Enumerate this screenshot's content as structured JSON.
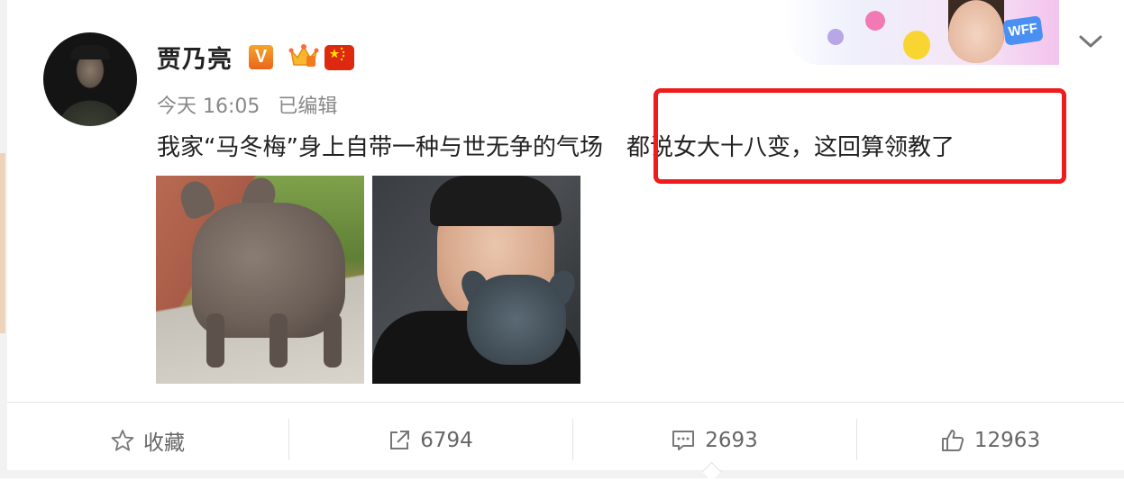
{
  "post": {
    "username": "贾乃亮",
    "verified_badge": "V",
    "timestamp": "今天 16:05",
    "edited_label": "已编辑",
    "text_part1": "我家“马冬梅”身上自带一种与世无争的气场",
    "text_part2": "都说女大十八变，这回算领教了",
    "highlight_color": "#ee1c1c",
    "images": [
      {
        "icon": "french-bulldog-photo"
      },
      {
        "icon": "man-with-puppy-photo"
      }
    ]
  },
  "banner": {
    "badge_text": "WFF"
  },
  "actions": {
    "favorite_label": "收藏",
    "repost_count": "6794",
    "comment_count": "2693",
    "like_count": "12963"
  },
  "colors": {
    "username": "#222222",
    "meta": "#888888",
    "action_text": "#666666",
    "vip_badge": "#f7a52a"
  }
}
